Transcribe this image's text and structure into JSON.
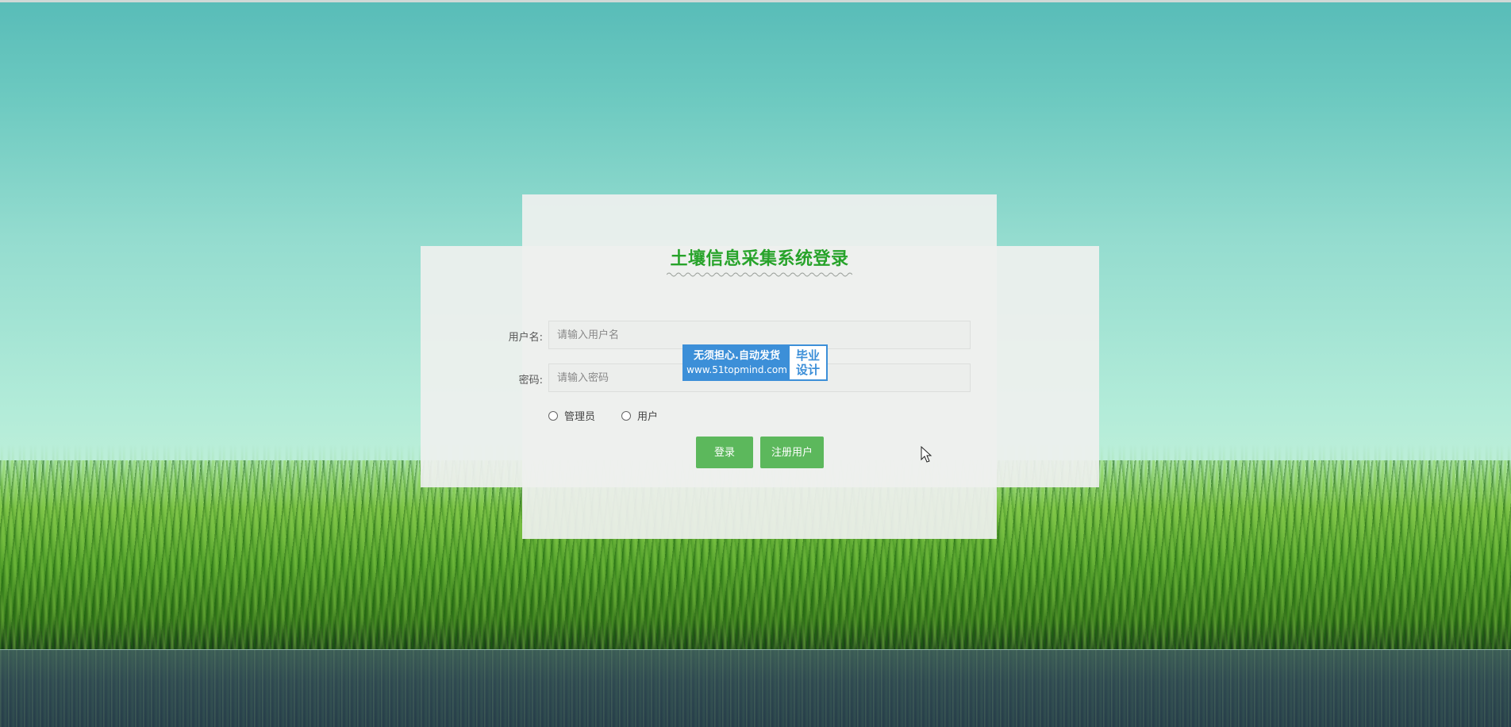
{
  "login": {
    "title": "土壤信息采集系统登录",
    "username_label": "用户名:",
    "username_placeholder": "请输入用户名",
    "username_value": "",
    "password_label": "密码:",
    "password_placeholder": "请输入密码",
    "password_value": "",
    "roles": [
      {
        "label": "管理员",
        "checked": false
      },
      {
        "label": "用户",
        "checked": false
      }
    ],
    "login_button": "登录",
    "register_button": "注册用户"
  },
  "watermark": {
    "line1": "无须担心.自动发货",
    "line2": "www.51topmind.com",
    "right_top": "毕业",
    "right_bottom": "设计"
  },
  "colors": {
    "title": "#27a32a",
    "button": "#5cb85c",
    "badge": "#3c8fd8"
  },
  "icons": {
    "cursor": "mouse-pointer-icon"
  }
}
